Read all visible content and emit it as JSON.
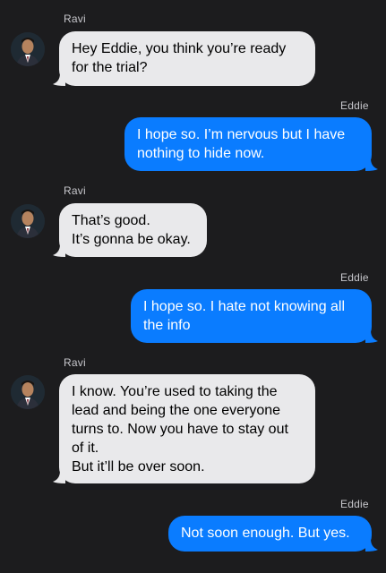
{
  "messages": [
    {
      "sender": "Ravi",
      "direction": "incoming",
      "text": "Hey Eddie, you think you’re ready\nfor the trial?"
    },
    {
      "sender": "Eddie",
      "direction": "outgoing",
      "text": "I hope so. I’m nervous but I have\nnothing to hide now."
    },
    {
      "sender": "Ravi",
      "direction": "incoming",
      "text": "That’s good.\nIt’s gonna be okay."
    },
    {
      "sender": "Eddie",
      "direction": "outgoing",
      "text": "I hope so. I hate not knowing all\nthe info"
    },
    {
      "sender": "Ravi",
      "direction": "incoming",
      "text": "I know. You’re used to taking the\nlead and being the one everyone\nturns to. Now you have to stay out\nof it.\nBut it’ll be over soon."
    },
    {
      "sender": "Eddie",
      "direction": "outgoing",
      "text": "Not soon enough. But yes."
    }
  ],
  "colors": {
    "background": "#1c1c1e",
    "incoming_bubble": "#e9e9eb",
    "outgoing_bubble": "#0a7cff",
    "sender_name": "#c7c7cc"
  },
  "icons": {
    "avatar": "avatar-icon"
  }
}
